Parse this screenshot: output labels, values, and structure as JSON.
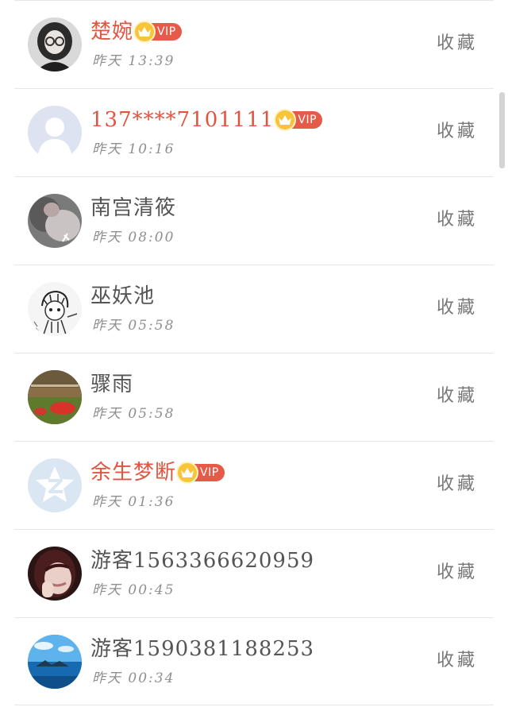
{
  "favorites": [
    {
      "name": "楚婉",
      "vip": true,
      "time": "昨天 13:39",
      "action": "收藏",
      "avatar": "woman-glasses-avatar"
    },
    {
      "name": "137****7101111",
      "vip": true,
      "time": "昨天 10:16",
      "action": "收藏",
      "avatar": "default-person-avatar"
    },
    {
      "name": "南宫清筱",
      "vip": false,
      "time": "昨天 08:00",
      "action": "收藏",
      "avatar": "photo-avatar"
    },
    {
      "name": "巫妖池",
      "vip": false,
      "time": "昨天 05:58",
      "action": "收藏",
      "avatar": "anime-sketch-avatar"
    },
    {
      "name": "骤雨",
      "vip": false,
      "time": "昨天 05:58",
      "action": "收藏",
      "avatar": "field-photo-avatar"
    },
    {
      "name": "余生梦断",
      "vip": true,
      "time": "昨天 01:36",
      "action": "收藏",
      "avatar": "z-logo-avatar"
    },
    {
      "name": "游客1563366620959",
      "vip": false,
      "time": "昨天 00:45",
      "action": "收藏",
      "avatar": "face-photo-avatar"
    },
    {
      "name": "游客1590381188253",
      "vip": false,
      "time": "昨天 00:34",
      "action": "收藏",
      "avatar": "seascape-avatar"
    }
  ],
  "vip_label": "VIP",
  "colors": {
    "vip_name": "#e2543f",
    "normal_name": "#555555",
    "time": "#8f8f8f",
    "badge": "#e55a48",
    "crown": "#f8c43a",
    "divider": "#e6e6e6"
  }
}
